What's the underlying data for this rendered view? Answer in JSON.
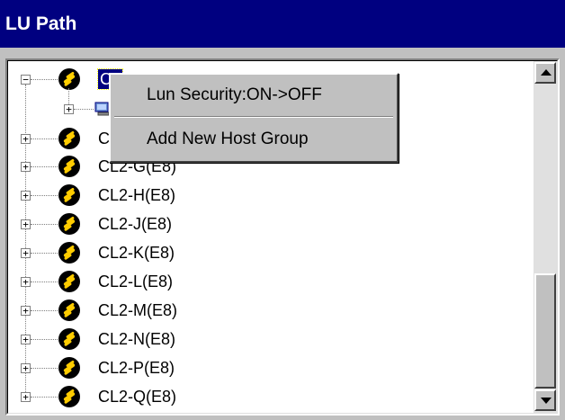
{
  "window": {
    "title": "LU Path"
  },
  "tree": {
    "selected_port_label": "CL",
    "collapsed_port_prefix": "Cl",
    "ports": [
      {
        "label": "CL2-G(E8)"
      },
      {
        "label": "CL2-H(E8)"
      },
      {
        "label": "CL2-J(E8)"
      },
      {
        "label": "CL2-K(E8)"
      },
      {
        "label": "CL2-L(E8)"
      },
      {
        "label": "CL2-M(E8)"
      },
      {
        "label": "CL2-N(E8)"
      },
      {
        "label": "CL2-P(E8)"
      },
      {
        "label": "CL2-Q(E8)"
      }
    ],
    "expander_collapsed": "+",
    "expander_expanded": "−"
  },
  "context_menu": {
    "items": [
      {
        "label": "Lun Security:ON->OFF"
      },
      {
        "label": "Add New Host Group"
      }
    ]
  },
  "scrollbar": {
    "position_fraction": 0.85
  },
  "icons": {
    "port": "fibre-port-icon",
    "host_group": "host-group-icon",
    "scroll_up": "scroll-up-arrow-icon",
    "scroll_down": "scroll-down-arrow-icon"
  },
  "colors": {
    "title_bar": "#000080",
    "selection": "#000080",
    "port_icon_accent": "#ffcc00"
  }
}
